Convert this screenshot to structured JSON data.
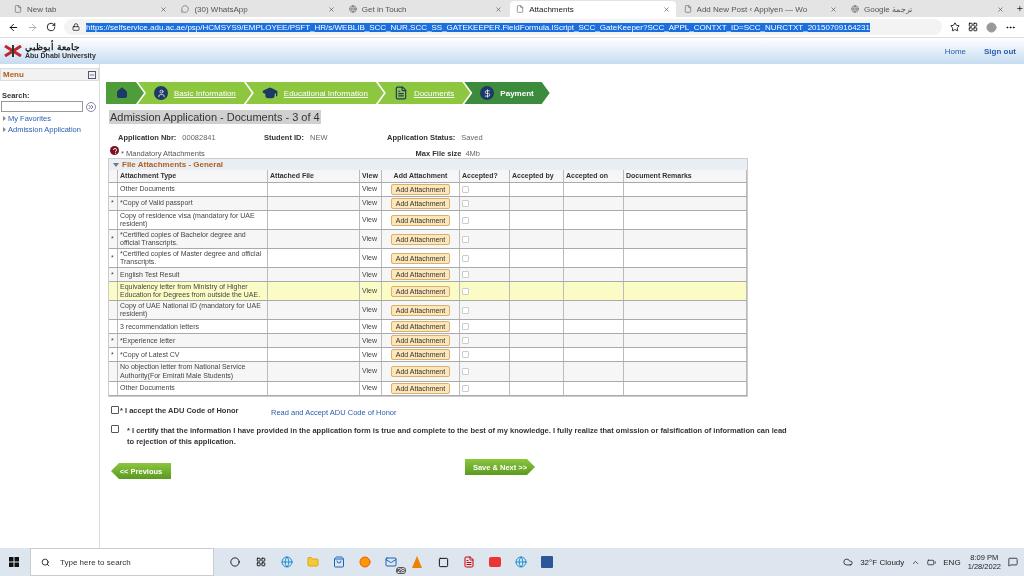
{
  "browser": {
    "tabs": [
      {
        "title": "New tab",
        "selected": false
      },
      {
        "title": "(30) WhatsApp",
        "selected": false
      },
      {
        "title": "Get in Touch",
        "selected": false
      },
      {
        "title": "Attachments",
        "selected": true
      },
      {
        "title": "Add New Post ‹ Applyen — Wo",
        "selected": false
      },
      {
        "title": "Google ترجمة",
        "selected": false
      }
    ],
    "url": "https://selfservice.adu.ac.ae/psp/HCMSYS9/EMPLOYEE/PSFT_HR/s/WEBLIB_SCC_NUR.SCC_SS_GATEKEEPER.FieldFormula.IScript_SCC_GateKeeper?SCC_APPL_CONTXT_ID=SCC_NURCTXT_20150709164231"
  },
  "header": {
    "logo_arabic": "جامعة أبوظبي",
    "logo_english": "Abu Dhabi University",
    "links": [
      "Home",
      "Sign out"
    ]
  },
  "menu": {
    "title": "Menu",
    "search_label": "Search:",
    "items": [
      "My Favorites",
      "Admission Application"
    ]
  },
  "steps": [
    {
      "kind": "home",
      "current": false
    },
    {
      "kind": "person",
      "label": "Basic Information",
      "current": false
    },
    {
      "kind": "cap",
      "label": "Educational Information",
      "current": false
    },
    {
      "kind": "document",
      "label": "Documents",
      "current": false
    },
    {
      "kind": "dollar",
      "label": "Payment",
      "current": true
    }
  ],
  "page_title": "Admission Application - Documents - 3 of 4",
  "info": [
    {
      "label": "Application Nbr:",
      "value": "00082841"
    },
    {
      "label": "Student ID:",
      "value": "NEW"
    },
    {
      "label": "Application Status:",
      "value": "Saved"
    }
  ],
  "mandatory_note": "* Mandatory Attachments",
  "max_file": {
    "label": "Max File size",
    "value": "4Mb"
  },
  "section_title": "File Attachments - General",
  "table": {
    "columns": [
      "Attachment Type",
      "Attached File",
      "View",
      "Add Attachment",
      "Accepted?",
      "Accepted by",
      "Accepted on",
      "Document Remarks"
    ],
    "rows": [
      {
        "type": "Other Documents",
        "view": "View",
        "button": "Add Attachment",
        "accepted": false,
        "highlighted": false
      },
      {
        "mark": "*",
        "type": "*Copy of Valid passport",
        "view": "View",
        "button": "Add Attachment",
        "accepted": false,
        "highlighted": false
      },
      {
        "type": "Copy of residence visa (mandatory for UAE resident)",
        "view": "View",
        "button": "Add Attachment",
        "accepted": false,
        "highlighted": false
      },
      {
        "mark": "*",
        "type": "*Certified copies of Bachelor degree and official Transcripts.",
        "view": "View",
        "button": "Add Attachment",
        "accepted": false,
        "highlighted": false
      },
      {
        "mark": "*",
        "type": "*Certified copies of Master degree and official Transcripts.",
        "view": "View",
        "button": "Add Attachment",
        "accepted": false,
        "highlighted": false
      },
      {
        "mark": "*",
        "type": "English Test Result",
        "view": "View",
        "button": "Add Attachment",
        "accepted": false,
        "highlighted": false
      },
      {
        "type": "Equivalency letter from Ministry of Higher Education for Degrees from outside the UAE.",
        "view": "View",
        "button": "Add Attachment",
        "accepted": false,
        "highlighted": true
      },
      {
        "type": "Copy of UAE National ID (mandatory for UAE resident)",
        "view": "View",
        "button": "Add Attachment",
        "accepted": false,
        "highlighted": false
      },
      {
        "type": "3 recommendation letters",
        "view": "View",
        "button": "Add Attachment",
        "accepted": false,
        "highlighted": false
      },
      {
        "mark": "*",
        "type": "*Experience letter",
        "view": "View",
        "button": "Add Attachment",
        "accepted": false,
        "highlighted": false
      },
      {
        "mark": "*",
        "type": "*Copy of Latest CV",
        "view": "View",
        "button": "Add Attachment",
        "accepted": false,
        "highlighted": false
      },
      {
        "type": "No objection letter from National Service Authority(For Emirati Male Students)",
        "view": "View",
        "button": "Add Attachment",
        "accepted": false,
        "highlighted": false
      },
      {
        "type": "Other Documents",
        "view": "View",
        "button": "Add Attachment",
        "accepted": false,
        "highlighted": false
      }
    ]
  },
  "honor": {
    "label": "* I accept the ADU Code of Honor",
    "checked": false,
    "link": "Read and Accept ADU Code of Honor"
  },
  "certify": {
    "label": "* I certify that the information I have provided in the application form is true and complete to the best of my knowledge. I fully realize that omission or falsification of information can lead to rejection of this application.",
    "checked": false
  },
  "buttons": {
    "previous": "<< Previous",
    "next": "Save & Next >>"
  },
  "taskbar": {
    "search_placeholder": "Type here to search",
    "mail_badge": "28",
    "weather": "32°F  Cloudy",
    "language": "ENG",
    "time": "8:09 PM",
    "date": "1/28/2022"
  }
}
